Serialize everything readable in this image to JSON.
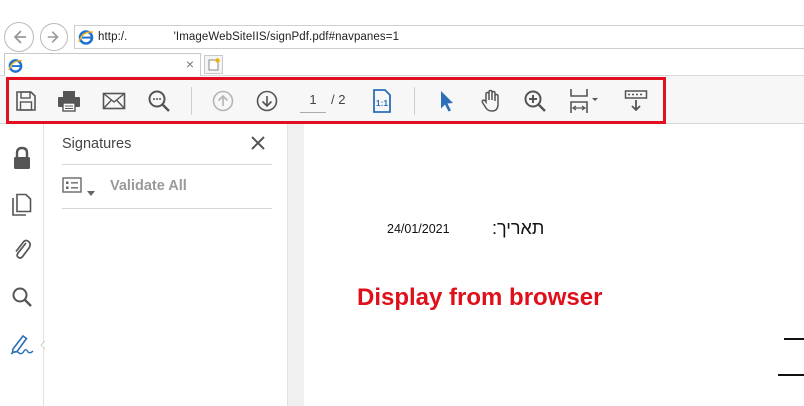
{
  "browser": {
    "url": "http:/.              'ImageWebSiteIIS/signPdf.pdf#navpanes=1",
    "tab_close": "×"
  },
  "toolbar": {
    "page_current": "1",
    "page_total": "/ 2"
  },
  "signatures_panel": {
    "title": "Signatures",
    "close": "✕",
    "validate_all": "Validate All"
  },
  "document": {
    "date": "24/01/2021",
    "hebrew_label": "תאריך:",
    "note": "Display from browser"
  },
  "colors": {
    "highlight": "#e01020",
    "accent_blue": "#2a6fb8",
    "note_red": "#e0101a"
  },
  "icons": [
    "back-icon",
    "forward-icon",
    "ie-icon",
    "save-icon",
    "print-icon",
    "email-icon",
    "search-zoom-icon",
    "page-up-icon",
    "page-down-icon",
    "fit-page-icon",
    "select-arrow-icon",
    "hand-icon",
    "zoom-in-icon",
    "page-size-icon",
    "toolbar-collapse-icon",
    "lock-icon",
    "pages-icon",
    "attachment-icon",
    "search-icon",
    "signature-pen-icon"
  ]
}
